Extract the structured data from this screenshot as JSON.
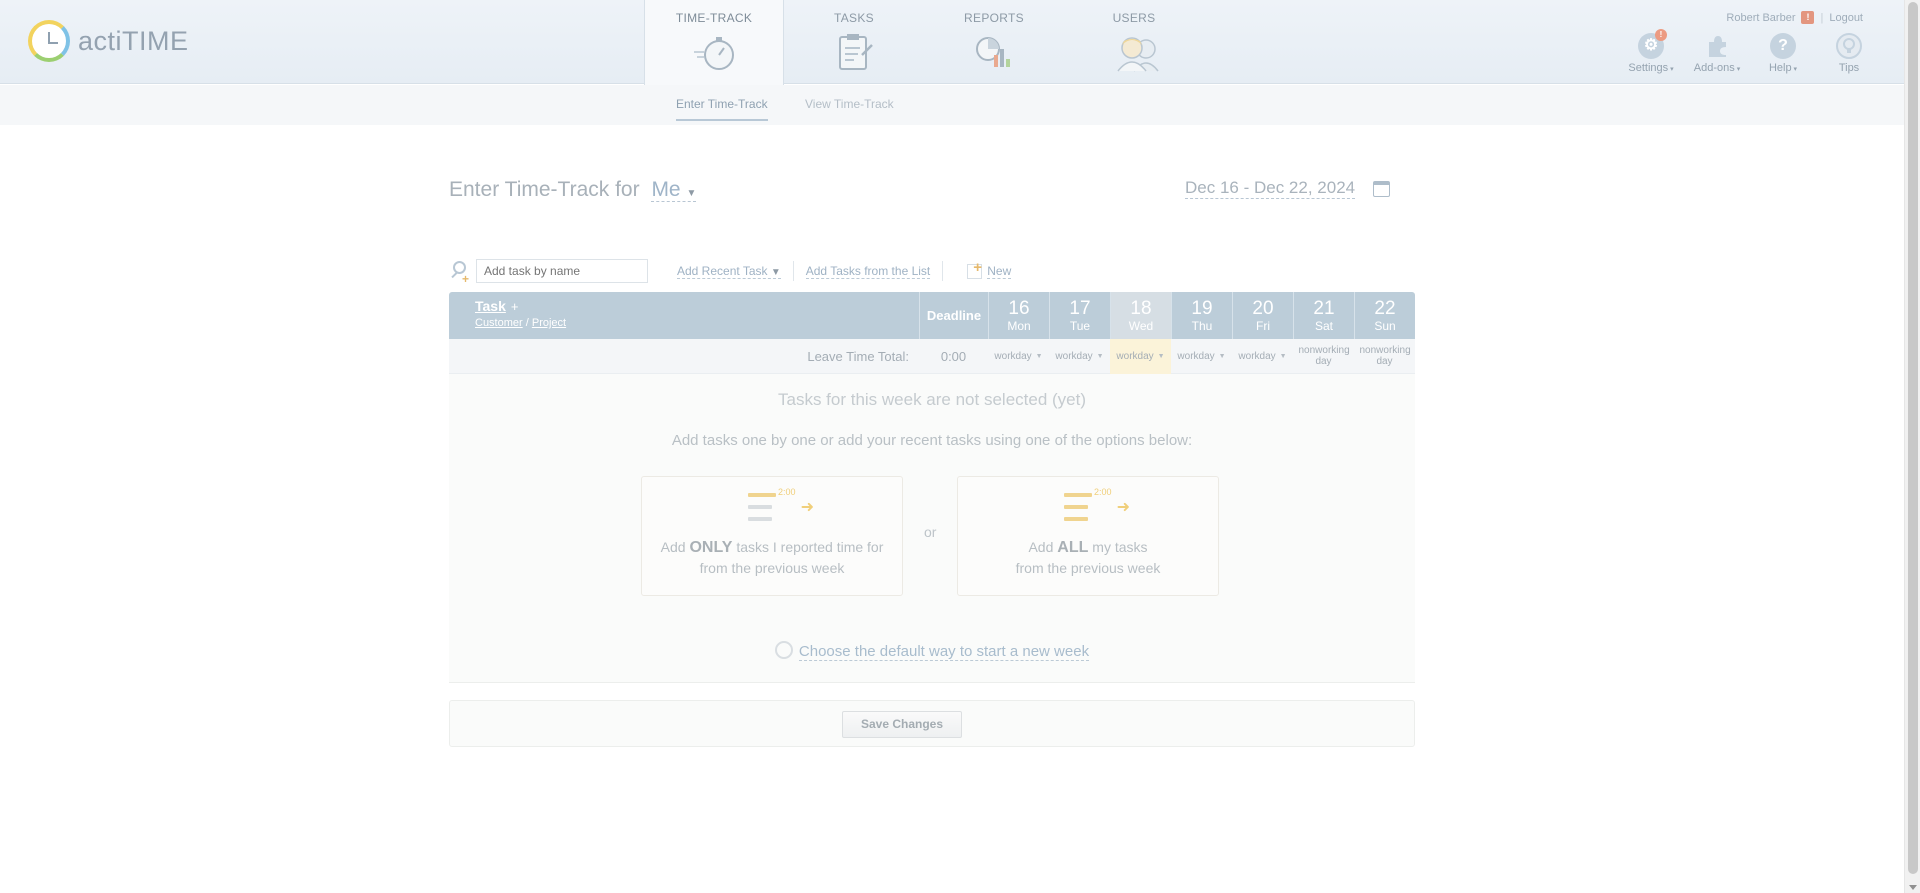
{
  "app": {
    "logo_text": "actiTIME"
  },
  "nav": {
    "tabs": [
      {
        "label": "TIME-TRACK",
        "active": true,
        "icon": "stopwatch-icon"
      },
      {
        "label": "TASKS",
        "active": false,
        "icon": "clipboard-icon"
      },
      {
        "label": "REPORTS",
        "active": false,
        "icon": "chart-icon"
      },
      {
        "label": "USERS",
        "active": false,
        "icon": "users-icon"
      }
    ],
    "subtabs": [
      {
        "label": "Enter Time-Track",
        "active": true
      },
      {
        "label": "View Time-Track",
        "active": false
      }
    ]
  },
  "user": {
    "name": "Robert Barber",
    "alert_badge": "!",
    "logout_label": "Logout"
  },
  "tools": [
    {
      "label": "Settings",
      "icon": "gear-icon",
      "badge": "!"
    },
    {
      "label": "Add-ons",
      "icon": "puzzle-icon"
    },
    {
      "label": "Help",
      "icon": "help-icon",
      "glyph": "?"
    },
    {
      "label": "Tips",
      "icon": "lightbulb-icon"
    }
  ],
  "page": {
    "title_prefix": "Enter Time-Track for",
    "who": "Me",
    "date_range": "Dec 16 - Dec 22, 2024"
  },
  "toolbar": {
    "search_placeholder": "Add task by name",
    "add_recent_label": "Add Recent Task",
    "add_from_list_label": "Add Tasks from the List",
    "new_label": "New"
  },
  "grid": {
    "task_header": "Task",
    "task_add": "+",
    "customer_label": "Customer",
    "slash": "/",
    "project_label": "Project",
    "deadline_header": "Deadline",
    "days": [
      {
        "num": "16",
        "name": "Mon",
        "today": false,
        "leave": "workday"
      },
      {
        "num": "17",
        "name": "Tue",
        "today": false,
        "leave": "workday"
      },
      {
        "num": "18",
        "name": "Wed",
        "today": true,
        "leave": "workday"
      },
      {
        "num": "19",
        "name": "Thu",
        "today": false,
        "leave": "workday"
      },
      {
        "num": "20",
        "name": "Fri",
        "today": false,
        "leave": "workday"
      },
      {
        "num": "21",
        "name": "Sat",
        "today": false,
        "leave": "nonworking day"
      },
      {
        "num": "22",
        "name": "Sun",
        "today": false,
        "leave": "nonworking day"
      }
    ],
    "leave_total_label": "Leave Time Total:",
    "leave_total_value": "0:00"
  },
  "empty_state": {
    "title": "Tasks for this week are not selected (yet)",
    "subtitle": "Add tasks one by one or add your recent tasks using one of the options below:",
    "option1": {
      "prefix": "Add",
      "emphasis": "ONLY",
      "suffix": "tasks I reported time for",
      "line2": "from the previous week",
      "icon_value": "2:00"
    },
    "or_label": "or",
    "option2": {
      "prefix": "Add",
      "emphasis": "ALL",
      "suffix": "my tasks",
      "line2": "from the previous week",
      "icon_value": "2:00"
    },
    "default_link": "Choose the default way to start a new week"
  },
  "actions": {
    "save_label": "Save Changes"
  }
}
